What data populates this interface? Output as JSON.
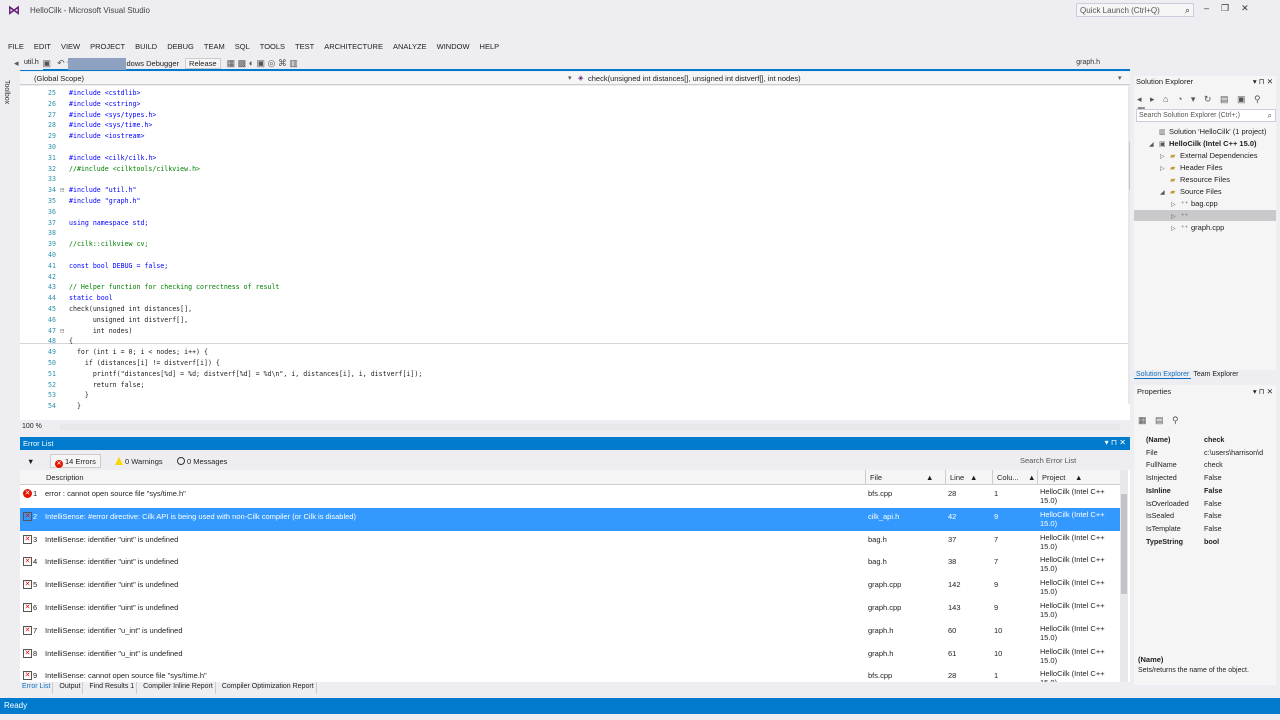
{
  "window": {
    "title": "HelloCilk - Microsoft Visual Studio",
    "quick_launch_placeholder": "Quick Launch (Ctrl+Q)",
    "logo_glyph": "⋈",
    "ql_icon_glyph": "⌕",
    "minimize_glyph": "–",
    "restore_glyph": "❐",
    "close_glyph": "✕"
  },
  "menu": [
    "FILE",
    "EDIT",
    "VIEW",
    "PROJECT",
    "BUILD",
    "DEBUG",
    "TEAM",
    "SQL",
    "TOOLS",
    "TEST",
    "ARCHITECTURE",
    "ANALYZE",
    "WINDOW",
    "HELP"
  ],
  "toolbar": {
    "run_label": "Local Windows Debugger",
    "config": "Release",
    "glyph_nav": "◂ ▸",
    "glyph_file": "▤ ▣",
    "glyph_undo": "↶ ↷",
    "glyph_play": "▶",
    "glyph_misc": "▦ ▩ ◐ ▣ ◎ ⌘ ▥"
  },
  "toolbox_label": "Toolbox",
  "editor": {
    "tabs": [
      "util.h",
      ""
    ],
    "tab_right": "graph.h",
    "scope_left": "(Global Scope)",
    "scope_right": "check(unsigned int distances[], unsigned int distverf[], int nodes)",
    "zoom": "100 %",
    "lines": [
      {
        "n": "25",
        "g": "",
        "t": "#include <cstdlib>"
      },
      {
        "n": "26",
        "g": "",
        "t": "#include <cstring>"
      },
      {
        "n": "27",
        "g": "",
        "t": "#include <sys/types.h>"
      },
      {
        "n": "28",
        "g": "",
        "t": "#include <sys/time.h>"
      },
      {
        "n": "29",
        "g": "",
        "t": "#include <iostream>"
      },
      {
        "n": "30",
        "g": "",
        "t": ""
      },
      {
        "n": "31",
        "g": "",
        "t": "#include <cilk/cilk.h>"
      },
      {
        "n": "32",
        "g": "",
        "t": "//#include <cilktools/cilkview.h>"
      },
      {
        "n": "33",
        "g": "",
        "t": ""
      },
      {
        "n": "34",
        "g": "⊟",
        "t": "#include \"util.h\""
      },
      {
        "n": "35",
        "g": "",
        "t": "#include \"graph.h\""
      },
      {
        "n": "36",
        "g": "",
        "t": ""
      },
      {
        "n": "37",
        "g": "",
        "t": "using namespace std;"
      },
      {
        "n": "38",
        "g": "",
        "t": ""
      },
      {
        "n": "39",
        "g": "",
        "t": "//cilk::cilkview cv;"
      },
      {
        "n": "40",
        "g": "",
        "t": ""
      },
      {
        "n": "41",
        "g": "",
        "t": "const bool DEBUG = false;"
      },
      {
        "n": "42",
        "g": "",
        "t": ""
      },
      {
        "n": "43",
        "g": "",
        "t": "// Helper function for checking correctness of result"
      },
      {
        "n": "44",
        "g": "",
        "t": "static bool"
      },
      {
        "n": "45",
        "g": "",
        "t": "check(unsigned int distances[],"
      },
      {
        "n": "46",
        "g": "",
        "t": "      unsigned int distverf[],"
      },
      {
        "n": "47",
        "g": "⊟",
        "t": "      int nodes)"
      },
      {
        "n": "48",
        "g": "",
        "t": "{"
      },
      {
        "n": "49",
        "g": "",
        "t": "  for (int i = 0; i < nodes; i++) {"
      },
      {
        "n": "50",
        "g": "",
        "t": "    if (distances[i] != distverf[i]) {"
      },
      {
        "n": "51",
        "g": "",
        "t": "      printf(\"distances[%d] = %d; distverf[%d] = %d\\n\", i, distances[i], i, distverf[i]);"
      },
      {
        "n": "52",
        "g": "",
        "t": "      return false;"
      },
      {
        "n": "53",
        "g": "",
        "t": "    }"
      },
      {
        "n": "54",
        "g": "",
        "t": "  }"
      }
    ]
  },
  "error_list": {
    "title": "Error List",
    "header_controls": "▾ ⊓ ✕",
    "filter_glyph": "▼",
    "errors": "14 Errors",
    "warnings": "0 Warnings",
    "messages": "0 Messages",
    "search_placeholder": "Search Error List",
    "search_icon": "⌕",
    "columns": {
      "description": "Description",
      "file": "File",
      "line": "Line",
      "column": "Colu...",
      "project": "Project"
    },
    "rows": [
      {
        "icon": "error",
        "num": "1",
        "desc": "error : cannot open source file \"sys/time.h\"",
        "file": "bfs.cpp",
        "line": "28",
        "col": "1",
        "project": "HelloCilk (Intel C++ 15.0)",
        "selected": false
      },
      {
        "icon": "intellisense",
        "num": "2",
        "desc": "IntelliSense: #error directive: Cilk API is being used with non-Cilk compiler (or Cilk is disabled)",
        "file": "cilk_api.h",
        "line": "42",
        "col": "9",
        "project": "HelloCilk (Intel C++ 15.0)",
        "selected": true
      },
      {
        "icon": "intellisense",
        "num": "3",
        "desc": "IntelliSense: identifier \"uint\" is undefined",
        "file": "bag.h",
        "line": "37",
        "col": "7",
        "project": "HelloCilk (Intel C++ 15.0)",
        "selected": false
      },
      {
        "icon": "intellisense",
        "num": "4",
        "desc": "IntelliSense: identifier \"uint\" is undefined",
        "file": "bag.h",
        "line": "38",
        "col": "7",
        "project": "HelloCilk (Intel C++ 15.0)",
        "selected": false
      },
      {
        "icon": "intellisense",
        "num": "5",
        "desc": "IntelliSense: identifier \"uint\" is undefined",
        "file": "graph.cpp",
        "line": "142",
        "col": "9",
        "project": "HelloCilk (Intel C++ 15.0)",
        "selected": false
      },
      {
        "icon": "intellisense",
        "num": "6",
        "desc": "IntelliSense: identifier \"uint\" is undefined",
        "file": "graph.cpp",
        "line": "143",
        "col": "9",
        "project": "HelloCilk (Intel C++ 15.0)",
        "selected": false
      },
      {
        "icon": "intellisense",
        "num": "7",
        "desc": "IntelliSense: identifier \"u_int\" is undefined",
        "file": "graph.h",
        "line": "60",
        "col": "10",
        "project": "HelloCilk (Intel C++ 15.0)",
        "selected": false
      },
      {
        "icon": "intellisense",
        "num": "8",
        "desc": "IntelliSense: identifier \"u_int\" is undefined",
        "file": "graph.h",
        "line": "61",
        "col": "10",
        "project": "HelloCilk (Intel C++ 15.0)",
        "selected": false
      },
      {
        "icon": "intellisense",
        "num": "9",
        "desc": "IntelliSense: cannot open source file \"sys/time.h\"",
        "file": "bfs.cpp",
        "line": "28",
        "col": "1",
        "project": "HelloCilk (Intel C++ 15.0)",
        "selected": false
      }
    ],
    "bottom_tabs": [
      "Error List",
      "Output",
      "Find Results 1",
      "Compiler Inline Report",
      "Compiler Optimization Report"
    ]
  },
  "status": "Ready",
  "solution_explorer": {
    "title": "Solution Explorer",
    "controls": "▾ ⊓ ✕",
    "toolbar_glyphs": "◂ ▸ ⌂ ◔ ▾ ↻ ▤ ▣ ⚲ ▦",
    "search_placeholder": "Search Solution Explorer (Ctrl+;)",
    "search_icon": "⌕",
    "tree": [
      {
        "label": "Solution 'HelloCilk' (1 project)",
        "indent": 1,
        "arrow": "",
        "kind": "solution",
        "bold": false,
        "selected": false
      },
      {
        "label": "HelloCilk (Intel C++ 15.0)",
        "indent": 1,
        "arrow": "◢",
        "kind": "project",
        "bold": true,
        "selected": false
      },
      {
        "label": "External Dependencies",
        "indent": 2,
        "arrow": "▷",
        "kind": "folder",
        "bold": false,
        "selected": false
      },
      {
        "label": "Header Files",
        "indent": 2,
        "arrow": "▷",
        "kind": "folder",
        "bold": false,
        "selected": false
      },
      {
        "label": "Resource Files",
        "indent": 2,
        "arrow": "",
        "kind": "folder",
        "bold": false,
        "selected": false
      },
      {
        "label": "Source Files",
        "indent": 2,
        "arrow": "◢",
        "kind": "folder",
        "bold": false,
        "selected": false
      },
      {
        "label": "bag.cpp",
        "indent": 3,
        "arrow": "▷",
        "kind": "cpp",
        "bold": false,
        "selected": false
      },
      {
        "label": "",
        "indent": 3,
        "arrow": "▷",
        "kind": "cpp",
        "bold": false,
        "selected": true
      },
      {
        "label": "graph.cpp",
        "indent": 3,
        "arrow": "▷",
        "kind": "cpp",
        "bold": false,
        "selected": false
      }
    ],
    "tabs": [
      "Solution Explorer",
      "Team Explorer"
    ]
  },
  "properties": {
    "title": "Properties",
    "controls": "▾ ⊓ ✕",
    "toolbar_glyphs": "▦ ▤ ⚲",
    "rows": [
      {
        "k": "(Name)",
        "v": "check",
        "bold": true
      },
      {
        "k": "File",
        "v": "c:\\users\\harrison\\d",
        "bold": false
      },
      {
        "k": "FullName",
        "v": "check",
        "bold": false
      },
      {
        "k": "IsInjected",
        "v": "False",
        "bold": false
      },
      {
        "k": "IsInline",
        "v": "False",
        "bold": true
      },
      {
        "k": "IsOverloaded",
        "v": "False",
        "bold": false
      },
      {
        "k": "IsSealed",
        "v": "False",
        "bold": false
      },
      {
        "k": "IsTemplate",
        "v": "False",
        "bold": false
      },
      {
        "k": "TypeString",
        "v": "bool",
        "bold": true
      }
    ],
    "desc_name": "(Name)",
    "desc_text": "Sets/returns the name of the object."
  }
}
